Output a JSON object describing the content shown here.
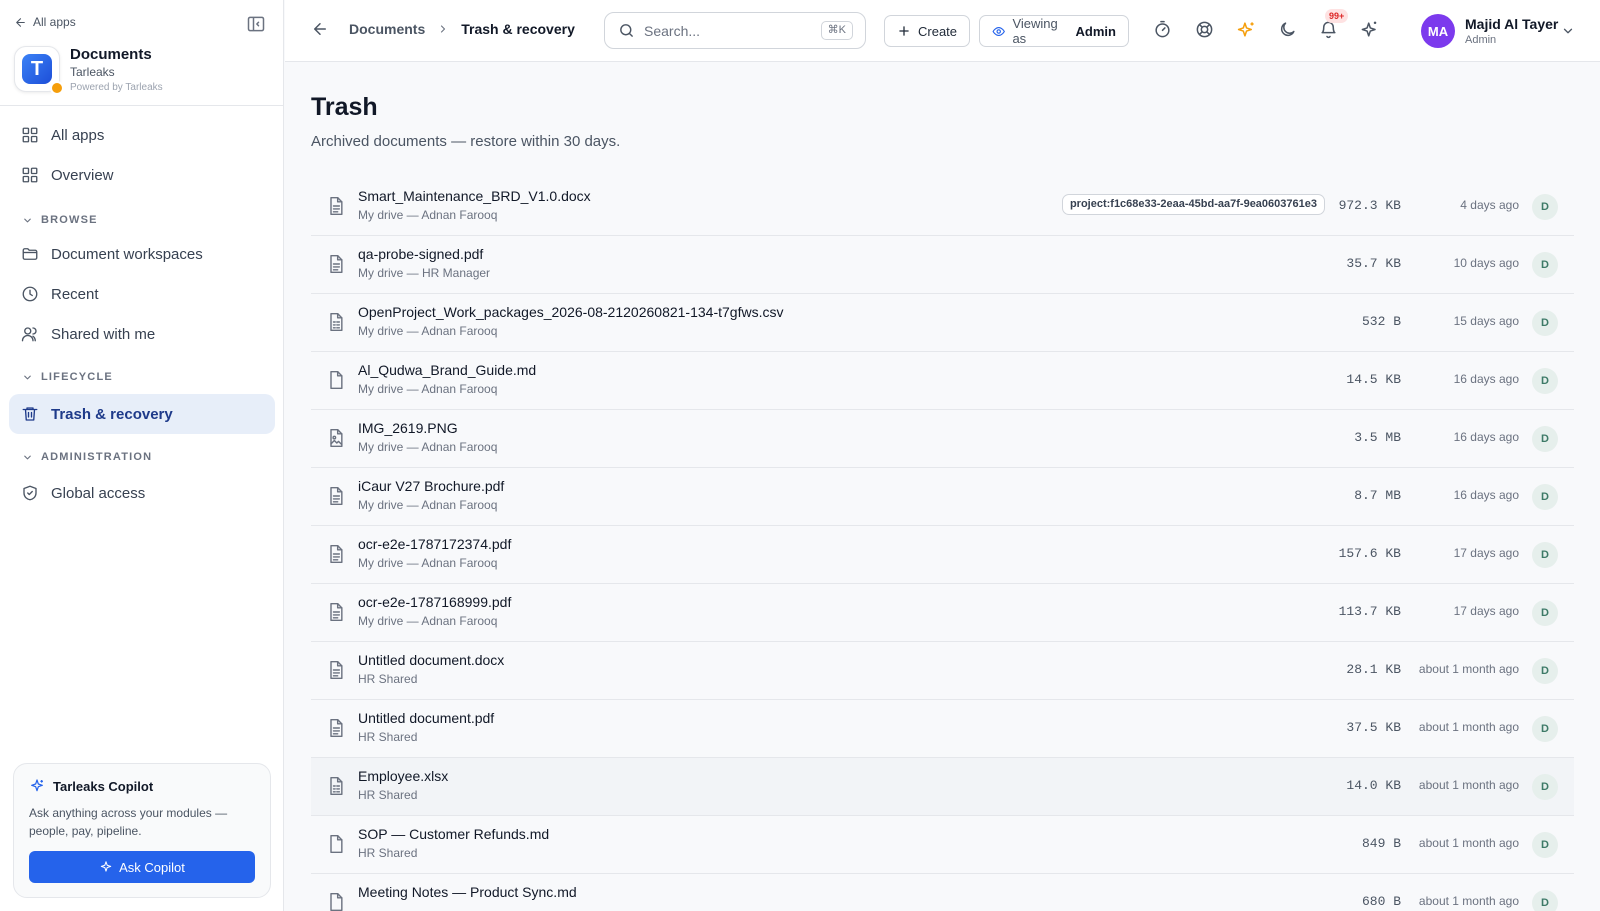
{
  "sidebar": {
    "back_label": "All apps",
    "app_title": "Documents",
    "org_name": "Tarleaks",
    "powered_by": "Powered by Tarleaks",
    "logo_letter": "T",
    "nav_top": [
      {
        "label": "All apps",
        "icon": "grid-icon"
      },
      {
        "label": "Overview",
        "icon": "grid-icon"
      }
    ],
    "sections": [
      {
        "title": "BROWSE",
        "items": [
          {
            "label": "Document workspaces",
            "icon": "folder-icon"
          },
          {
            "label": "Recent",
            "icon": "clock-icon"
          },
          {
            "label": "Shared with me",
            "icon": "users-icon"
          }
        ]
      },
      {
        "title": "LIFECYCLE",
        "items": [
          {
            "label": "Trash & recovery",
            "icon": "trash-icon",
            "active": true
          }
        ]
      },
      {
        "title": "ADMINISTRATION",
        "items": [
          {
            "label": "Global access",
            "icon": "shield-check-icon"
          }
        ]
      }
    ],
    "copilot": {
      "title": "Tarleaks Copilot",
      "description": "Ask anything across your modules — people, pay, pipeline.",
      "button_label": "Ask Copilot"
    }
  },
  "topbar": {
    "breadcrumb_parent": "Documents",
    "breadcrumb_current": "Trash & recovery",
    "search_placeholder": "Search...",
    "search_shortcut": "⌘K",
    "create_label": "Create",
    "viewing_as_label": "Viewing as",
    "viewing_as_role": "Admin",
    "notification_count": "99+",
    "user": {
      "initials": "MA",
      "name": "Majid Al Tayer",
      "role": "Admin"
    }
  },
  "main": {
    "title": "Trash",
    "subtitle": "Archived documents — restore within 30 days.",
    "files": [
      {
        "name": "Smart_Maintenance_BRD_V1.0.docx",
        "location": "My drive — Adnan Farooq",
        "tag": "project:f1c68e33-2eaa-45bd-aa7f-9ea0603761e3",
        "size": "972.3 KB",
        "date": "4 days ago",
        "badge": "D",
        "type": "doc"
      },
      {
        "name": "qa-probe-signed.pdf",
        "location": "My drive — HR Manager",
        "size": "35.7 KB",
        "date": "10 days ago",
        "badge": "D",
        "type": "doc"
      },
      {
        "name": "OpenProject_Work_packages_2026-08-2120260821-134-t7gfws.csv",
        "location": "My drive — Adnan Farooq",
        "size": "532 B",
        "date": "15 days ago",
        "badge": "D",
        "type": "sheet"
      },
      {
        "name": "Al_Qudwa_Brand_Guide.md",
        "location": "My drive — Adnan Farooq",
        "size": "14.5 KB",
        "date": "16 days ago",
        "badge": "D",
        "type": "blank"
      },
      {
        "name": "IMG_2619.PNG",
        "location": "My drive — Adnan Farooq",
        "size": "3.5 MB",
        "date": "16 days ago",
        "badge": "D",
        "type": "image"
      },
      {
        "name": "iCaur V27 Brochure.pdf",
        "location": "My drive — Adnan Farooq",
        "size": "8.7 MB",
        "date": "16 days ago",
        "badge": "D",
        "type": "doc"
      },
      {
        "name": "ocr-e2e-1787172374.pdf",
        "location": "My drive — Adnan Farooq",
        "size": "157.6 KB",
        "date": "17 days ago",
        "badge": "D",
        "type": "doc"
      },
      {
        "name": "ocr-e2e-1787168999.pdf",
        "location": "My drive — Adnan Farooq",
        "size": "113.7 KB",
        "date": "17 days ago",
        "badge": "D",
        "type": "doc"
      },
      {
        "name": "Untitled document.docx",
        "location": "HR Shared",
        "size": "28.1 KB",
        "date": "about 1 month ago",
        "badge": "D",
        "type": "doc"
      },
      {
        "name": "Untitled document.pdf",
        "location": "HR Shared",
        "size": "37.5 KB",
        "date": "about 1 month ago",
        "badge": "D",
        "type": "doc"
      },
      {
        "name": "Employee.xlsx",
        "location": "HR Shared",
        "size": "14.0 KB",
        "date": "about 1 month ago",
        "badge": "D",
        "type": "sheet",
        "highlight": true
      },
      {
        "name": "SOP — Customer Refunds.md",
        "location": "HR Shared",
        "size": "849 B",
        "date": "about 1 month ago",
        "badge": "D",
        "type": "blank"
      },
      {
        "name": "Meeting Notes — Product Sync.md",
        "location": "",
        "size": "680 B",
        "date": "about 1 month ago",
        "badge": "D",
        "type": "blank"
      }
    ]
  },
  "colors": {
    "accent": "#2563eb",
    "active_nav_bg": "#e7eef9",
    "avatar": "#7c3aed",
    "badge_bg": "#e6efec"
  }
}
